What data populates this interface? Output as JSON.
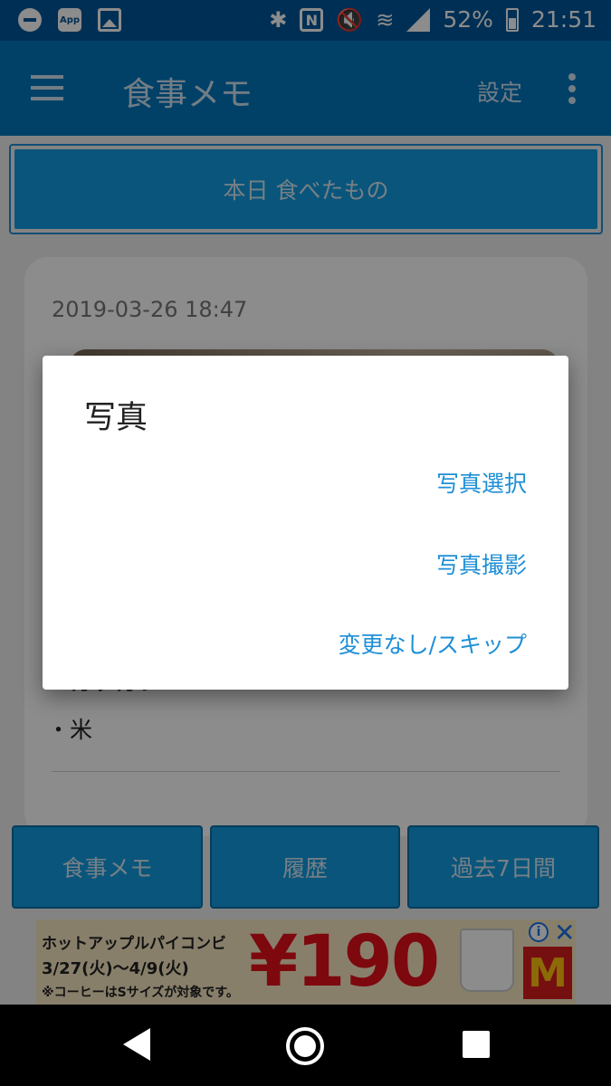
{
  "status_bar": {
    "battery": "52%",
    "time": "21:51",
    "app_badge": "App",
    "nfc_letter": "N",
    "bluetooth_glyph": "✱",
    "mute_glyph": "🔇",
    "wifi_glyph": "≋",
    "icons": [
      "dnd-icon",
      "app-icon",
      "image-icon",
      "bluetooth-icon",
      "nfc-icon",
      "mute-icon",
      "wifi-icon",
      "signal-icon",
      "battery-icon"
    ]
  },
  "app_bar": {
    "title": "食事メモ",
    "settings_label": "設定"
  },
  "main": {
    "today_button": "本日 食べたもの",
    "card": {
      "date": "2019-03-26 18:47",
      "items": [
        "・カツカレー",
        "・米"
      ]
    },
    "tabs": [
      {
        "label": "食事メモ"
      },
      {
        "label": "履歴"
      },
      {
        "label": "過去7日間"
      }
    ]
  },
  "ad": {
    "line1": "ホットアップルパイコンビ",
    "line2": "3/27(火)〜4/9(火)",
    "line3": "※コーヒーはSサイズが対象です。",
    "price": "¥190",
    "logo": "M",
    "info": "i",
    "close": "✕"
  },
  "dialog": {
    "title": "写真",
    "actions": [
      "写真選択",
      "写真撮影",
      "変更なし/スキップ"
    ]
  },
  "colors": {
    "primary": "#0277bd",
    "primary_dark": "#01579b",
    "button": "#139be0",
    "accent_text": "#1e8fd6"
  }
}
